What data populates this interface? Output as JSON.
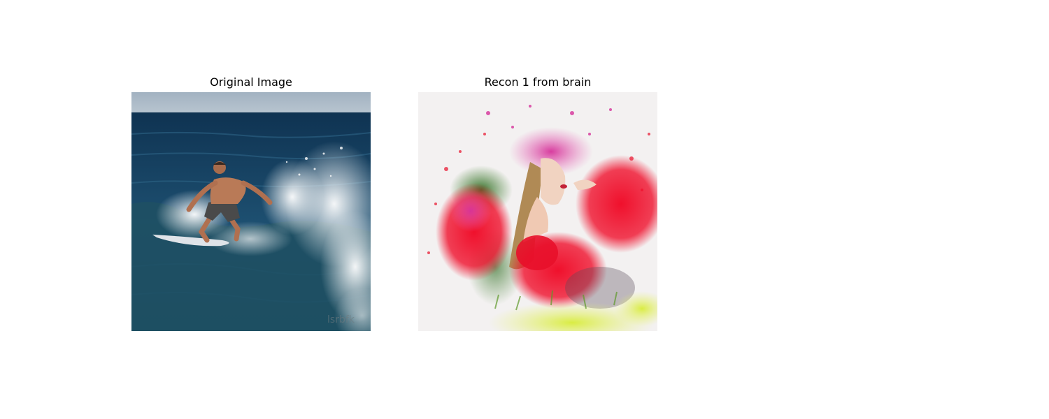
{
  "figure": {
    "panels": [
      {
        "title": "Original Image",
        "image_description_icon": "surfer-photo"
      },
      {
        "title": "Recon 1 from brain",
        "image_description_icon": "floral-portrait-painting"
      }
    ],
    "colors": {
      "sky": "#a9b8c6",
      "ocean_deep": "#12395a",
      "ocean_mid": "#1f5577",
      "foam": "#eef1f3",
      "skin": "#b97a57",
      "shorts": "#4a4a4a",
      "board": "#dfe3e8",
      "paint_bg": "#f3f1f1",
      "rose_red": "#e8102a",
      "magenta": "#d6339a",
      "leaf_green": "#3f7d2c",
      "lime": "#d8ec3a",
      "hair": "#b08a55",
      "face": "#f1d3c1"
    }
  }
}
